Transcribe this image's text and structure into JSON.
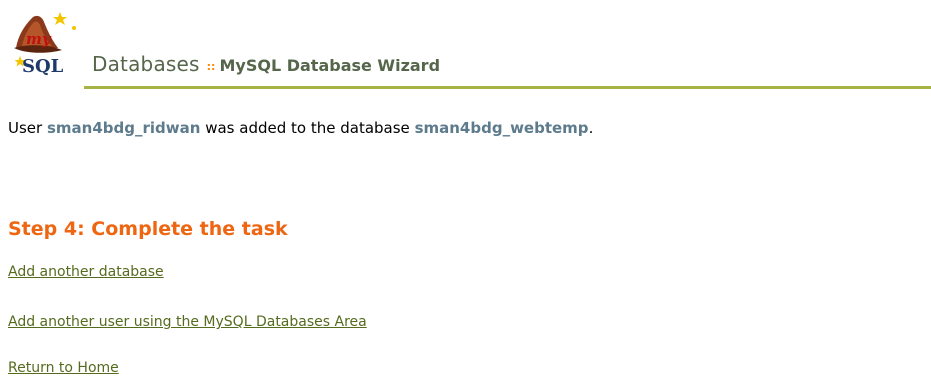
{
  "header": {
    "logo_text": "mySQL",
    "title": "Databases",
    "separator": "::",
    "subtitle": "MySQL Database Wizard"
  },
  "message": {
    "prefix": "User",
    "user": "sman4bdg_ridwan",
    "middle": "was added to the database",
    "database": "sman4bdg_webtemp",
    "suffix": "."
  },
  "step": {
    "heading": "Step 4: Complete the task"
  },
  "links": {
    "add_database": "Add another database",
    "add_user": "Add another user using the MySQL Databases Area",
    "return_home": "Return to Home"
  },
  "colors": {
    "title": "#55664a",
    "separator": "#ff8800",
    "underline": "#a7b445",
    "highlight_name": "#5d7b8c",
    "step_heading": "#ee6611",
    "link": "#556b1e"
  }
}
